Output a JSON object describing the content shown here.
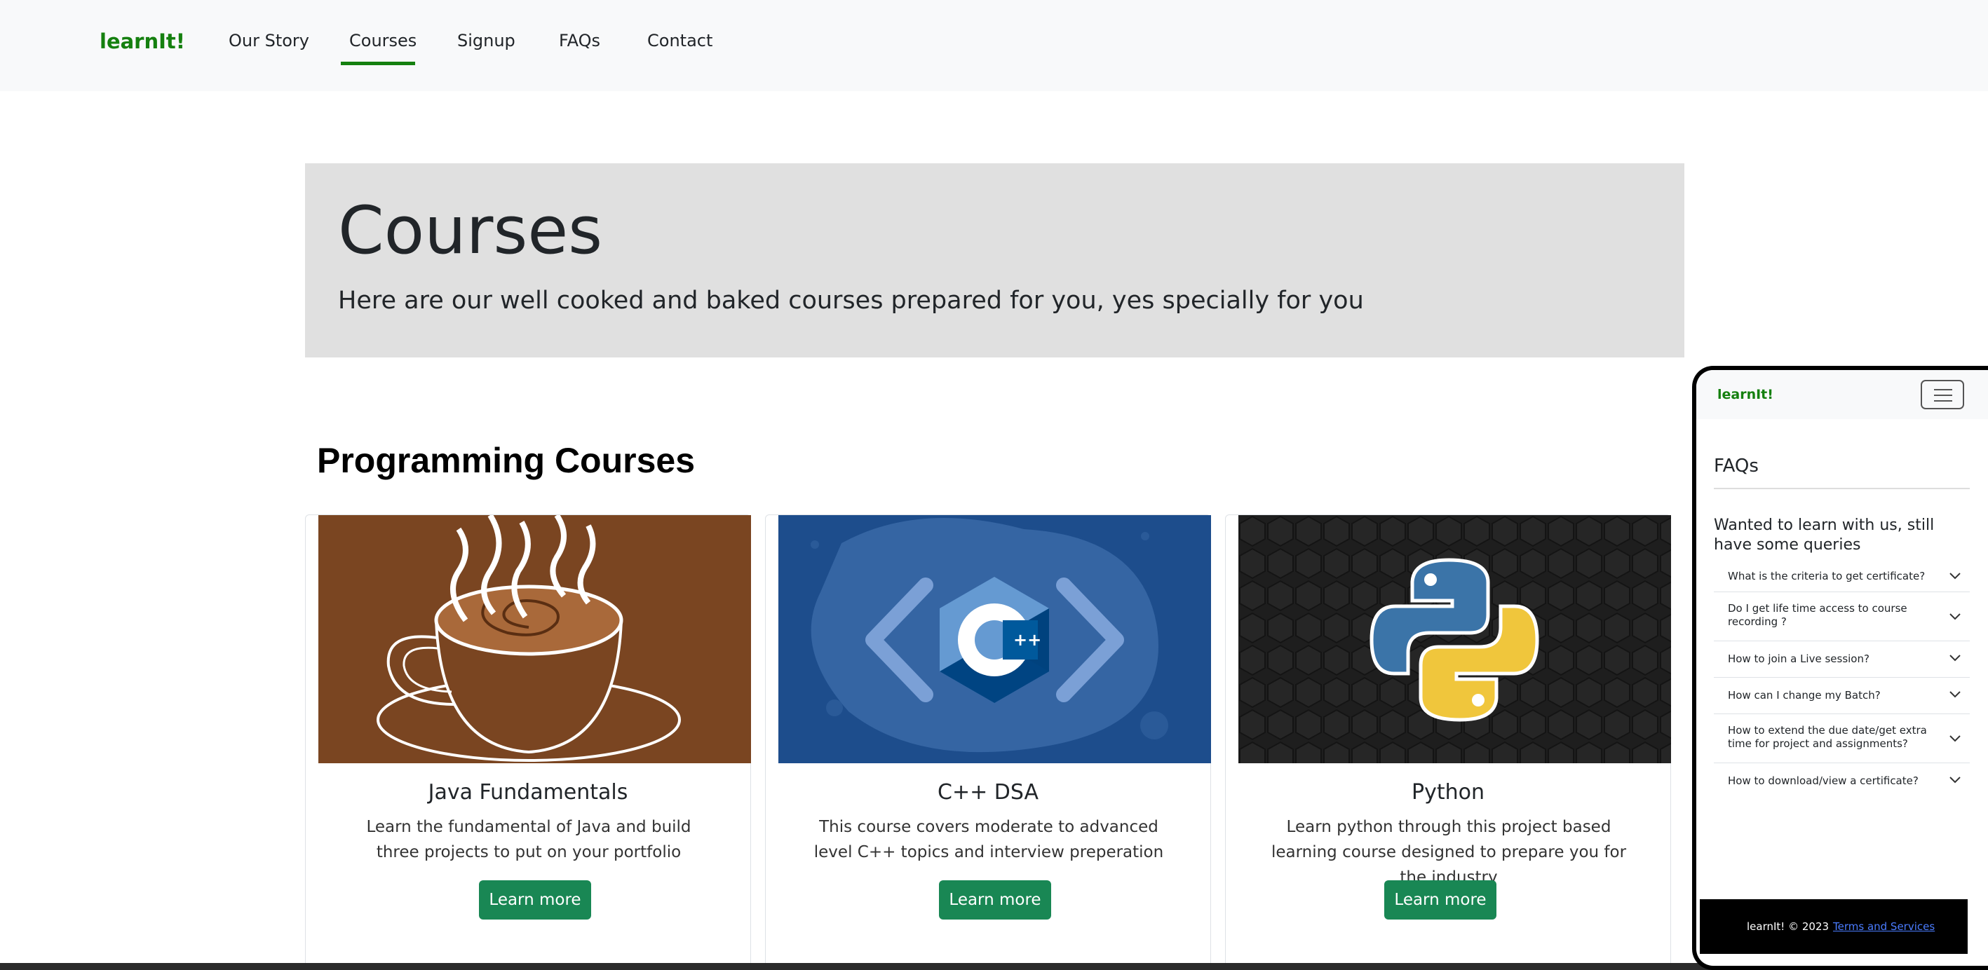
{
  "navbar": {
    "brand": "learnIt!",
    "links": [
      "Our Story",
      "Courses",
      "Signup",
      "FAQs",
      "Contact"
    ],
    "active": "Courses"
  },
  "hero": {
    "title": "Courses",
    "subtitle": "Here are our well cooked and baked courses prepared for you, yes specially for you"
  },
  "section": {
    "title": "Programming Courses"
  },
  "courses": [
    {
      "title": "Java Fundamentals",
      "text": "Learn the fundamental of Java and build three projects to put on your portfolio",
      "button": "Learn more",
      "image": "coffee-cup-image"
    },
    {
      "title": "C++ DSA",
      "text": "This course covers moderate to advanced level C++ topics and interview preperation",
      "button": "Learn more",
      "image": "cpp-logo-image"
    },
    {
      "title": "Python",
      "text": "Learn python through this project based learning course designed to prepare you for the industry",
      "button": "Learn more",
      "image": "python-logo-image"
    }
  ],
  "phone": {
    "brand": "learnIt!",
    "faq_title": "FAQs",
    "heading": "Wanted to learn with us, still have some queries",
    "faqs": [
      "What is the criteria to get certificate?",
      "Do I get life time access to course recording ?",
      "How to join a Live session?",
      "How can I change my Batch?",
      "How to extend the due date/get extra time for project and assignments?",
      "How to download/view a certificate?"
    ],
    "footer": {
      "copyright": "learnIt! © 2023",
      "terms": "Terms and Services"
    }
  },
  "colors": {
    "brand": "#15800f",
    "button": "#198754",
    "hero_bg": "#e0e0e0"
  }
}
